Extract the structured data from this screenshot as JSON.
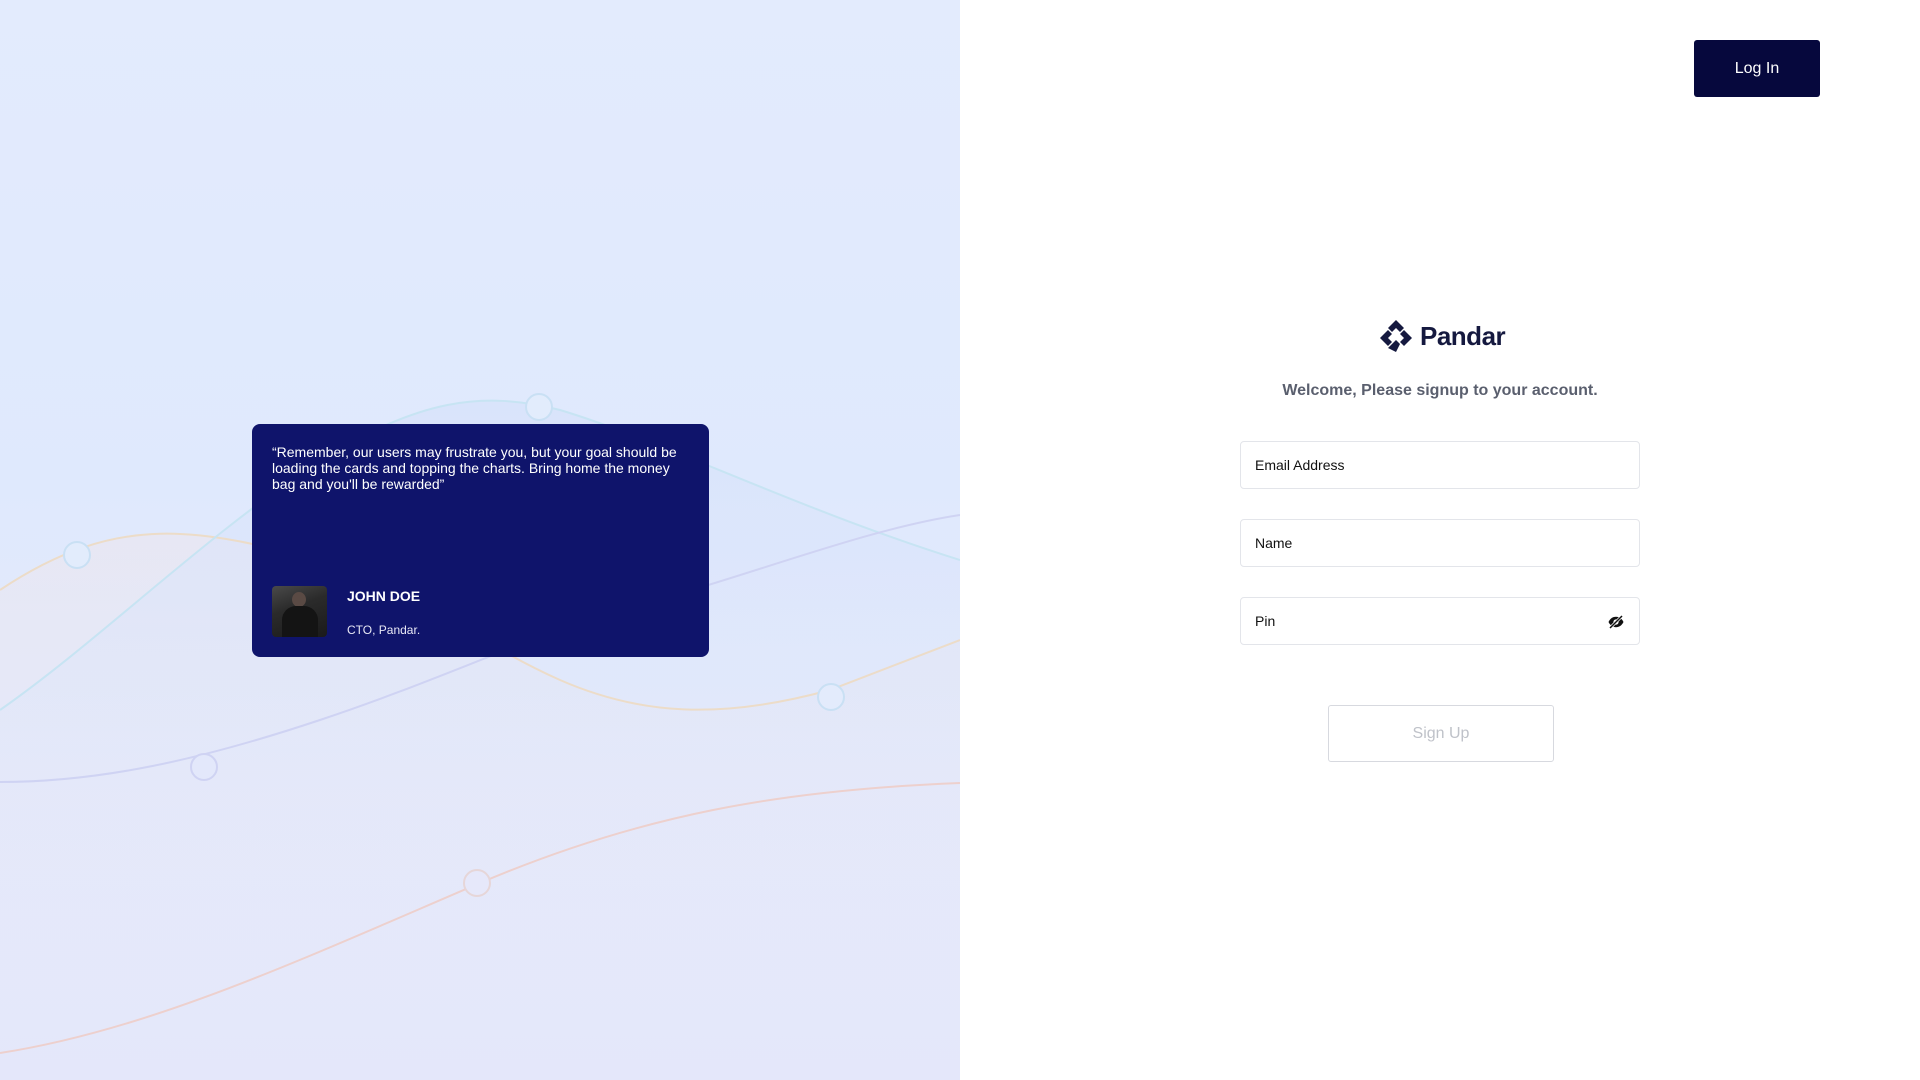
{
  "testimonial": {
    "quote": "“Remember, our users may frustrate you, but your goal should be loading the cards and topping the charts. Bring home the money bag and you'll be rewarded”",
    "author_name": "JOHN DOE",
    "author_role": "CTO, Pandar."
  },
  "header": {
    "login_label": "Log In"
  },
  "brand": {
    "name": "Pandar",
    "logo_icon": "pandar-logo-icon"
  },
  "form": {
    "welcome": "Welcome, Please signup to your account.",
    "email_placeholder": "Email Address",
    "name_placeholder": "Name",
    "pin_placeholder": "Pin",
    "pin_toggle_icon": "eye-slash-icon",
    "signup_label": "Sign Up"
  },
  "colors": {
    "card_bg": "#0f146b",
    "login_button_bg": "#06083d",
    "left_panel_bg": "#e3ebfd"
  }
}
